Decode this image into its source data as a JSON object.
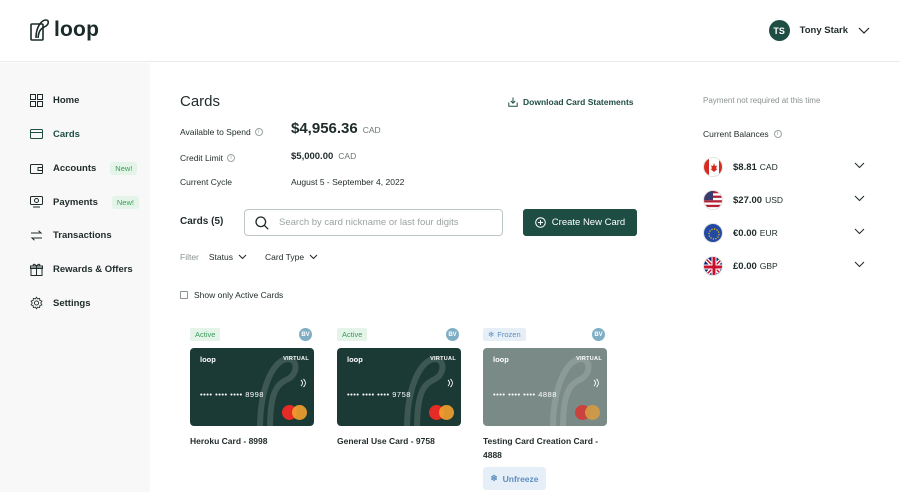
{
  "app": {
    "logo_text": "loop"
  },
  "user": {
    "initials": "TS",
    "name": "Tony Stark"
  },
  "sidebar": {
    "items": [
      {
        "label": "Home",
        "badge": ""
      },
      {
        "label": "Cards",
        "badge": ""
      },
      {
        "label": "Accounts",
        "badge": "New!"
      },
      {
        "label": "Payments",
        "badge": "New!"
      },
      {
        "label": "Transactions",
        "badge": ""
      },
      {
        "label": "Rewards & Offers",
        "badge": ""
      },
      {
        "label": "Settings",
        "badge": ""
      }
    ]
  },
  "main": {
    "title": "Cards",
    "download_label": "Download Card Statements",
    "available": {
      "label": "Available to Spend",
      "value": "$4,956.36",
      "currency": "CAD"
    },
    "credit_limit": {
      "label": "Credit Limit",
      "value": "$5,000.00",
      "currency": "CAD"
    },
    "cycle": {
      "label": "Current Cycle",
      "value": "August 5 - September 4, 2022"
    },
    "cards_count": "Cards (5)",
    "search_placeholder": "Search by card nickname or last four digits",
    "create_label": "Create New Card",
    "filter_label": "Filter",
    "filter_status": "Status",
    "filter_type": "Card Type",
    "active_only_label": "Show only Active Cards",
    "cards": [
      {
        "status": "Active",
        "bv": "BV",
        "brand": "loop",
        "virtual": "VIRTUAL",
        "number": "•••• •••• •••• 8998",
        "name": "Heroku Card - 8998"
      },
      {
        "status": "Active",
        "bv": "BV",
        "brand": "loop",
        "virtual": "VIRTUAL",
        "number": "•••• •••• •••• 9758",
        "name": "General Use Card - 9758"
      },
      {
        "status": "Frozen",
        "bv": "BV",
        "brand": "loop",
        "virtual": "VIRTUAL",
        "number": "•••• •••• •••• 4888",
        "name": "Testing Card Creation Card - 4888"
      }
    ],
    "unfreeze_label": "Unfreeze"
  },
  "right": {
    "payment_note": "Payment not required at this time",
    "balances_title": "Current Balances",
    "balances": [
      {
        "amount": "$8.81",
        "currency": "CAD",
        "flag": "ca-flag"
      },
      {
        "amount": "$27.00",
        "currency": "USD",
        "flag": "us-flag"
      },
      {
        "amount": "€0.00",
        "currency": "EUR",
        "flag": "eu-flag"
      },
      {
        "amount": "£0.00",
        "currency": "GBP",
        "flag": "gb-flag"
      }
    ]
  },
  "colors": {
    "accent": "#1e4d44",
    "active": "#3a9b5a",
    "frozen": "#5c8fc0",
    "sidebar_bg": "#f7f8f7"
  }
}
